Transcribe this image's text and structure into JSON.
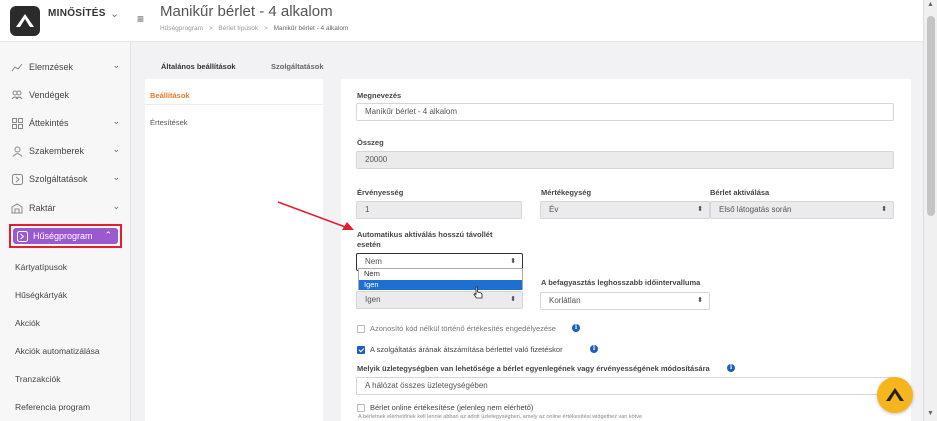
{
  "brand": {
    "name": "MINŐSÍTÉS"
  },
  "header": {
    "title": "Manikűr bérlet - 4 alkalom",
    "breadcrumb": [
      "Hűségprogram",
      "Bérlet típusok",
      "Manikűr bérlet - 4 alkalom"
    ],
    "breadcrumb_sep": ">"
  },
  "sidebar": {
    "items": [
      {
        "label": "Elemzések",
        "icon": "chart-icon",
        "has_chevron": true
      },
      {
        "label": "Vendégek",
        "icon": "users-icon",
        "has_chevron": false
      },
      {
        "label": "Áttekintés",
        "icon": "grid-icon",
        "has_chevron": true
      },
      {
        "label": "Szakemberek",
        "icon": "person-icon",
        "has_chevron": true
      },
      {
        "label": "Szolgáltatások",
        "icon": "service-icon",
        "has_chevron": true
      },
      {
        "label": "Raktár",
        "icon": "warehouse-icon",
        "has_chevron": true
      }
    ],
    "active": {
      "label": "Hűségprogram",
      "icon": "loyalty-icon",
      "accent": "#9b59d0",
      "highlight": "#e0202f"
    },
    "subitems": [
      "Kártyatípusok",
      "Hűségkártyák",
      "Akciók",
      "Akciók automatizálása",
      "Tranzakciók",
      "Referencia program"
    ]
  },
  "tabs": [
    {
      "label": "Általános beállítások",
      "active": true
    },
    {
      "label": "Szolgáltatások",
      "active": false
    }
  ],
  "left_panel": {
    "items": [
      {
        "label": "Beállítások",
        "active": true,
        "color": "#e8792a"
      },
      {
        "label": "Értesítések",
        "active": false
      }
    ]
  },
  "form": {
    "name": {
      "label": "Megnevezés",
      "value": "Manikűr bérlet - 4 alkalom"
    },
    "amount": {
      "label": "Összeg",
      "value": "20000"
    },
    "validity": {
      "label": "Érvényesség",
      "value": "1"
    },
    "unit": {
      "label": "Mértékegység",
      "value": "Év"
    },
    "activation": {
      "label": "Bérlet aktiválása",
      "value": "Első látogatás során"
    },
    "auto_activation": {
      "label": "Automatikus aktiválás hosszú távollét esetén",
      "value": "Nem",
      "options": [
        "Nem",
        "Igen"
      ],
      "highlighted_option": "Igen"
    },
    "freeze": {
      "value": "Igen"
    },
    "freeze_interval": {
      "label": "A befagyasztás leghosszabb időintervalluma",
      "value": "Korlátlan"
    },
    "checkbox_code": {
      "label": "Azonosító kód nélkül történő értékesítés engedélyezése",
      "checked": false
    },
    "checkbox_price": {
      "label": "A szolgáltatás árának átszámítása bérlettel való fizetéskor",
      "checked": true
    },
    "stores": {
      "label": "Melyik üzletegységben van lehetősége a bérlet egyenlegének vagy érvényességének módosítására",
      "value": "A hálózat összes üzletegységében"
    },
    "checkbox_online": {
      "label": "Bérlet online értékesítése (jelenleg nem elérhető)",
      "checked": false
    },
    "online_note": "A bérletnek elérhetőnek kell lennie abban az adott üzletegységben, amely az online értékesítési widgethez van kötve"
  },
  "colors": {
    "brand_dark": "#2b2b2b",
    "fab": "#f5b51c",
    "link_blue": "#1f5fbf"
  }
}
